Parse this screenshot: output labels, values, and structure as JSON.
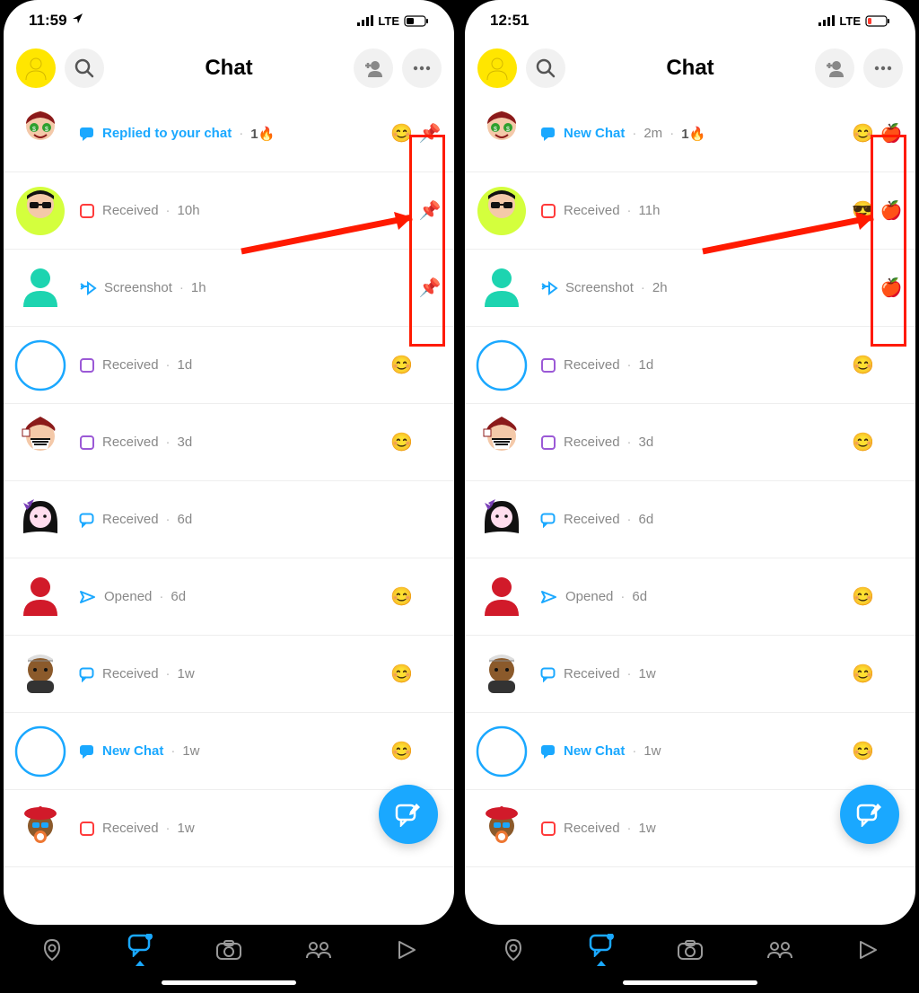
{
  "screens": [
    {
      "status": {
        "time": "11:59",
        "location_icon": true,
        "network": "LTE",
        "battery_low": false
      },
      "header": {
        "title": "Chat"
      },
      "pin_emoji": "📌",
      "rows": [
        {
          "avatar": "money-eyes",
          "status_icon": "chat-filled-blue",
          "status_text": "Replied to your chat",
          "status_bold": true,
          "time": "",
          "streak": "1",
          "right_emoji": "😊",
          "pinned": true
        },
        {
          "avatar": "sunglasses-guy",
          "status_icon": "box-outline-red",
          "status_text": "Received",
          "time": "10h",
          "right_emoji": "",
          "pinned": true
        },
        {
          "avatar": "teal-silhouette",
          "status_icon": "screenshot-blue",
          "status_text": "Screenshot",
          "time": "1h",
          "right_emoji": "",
          "pinned": true
        },
        {
          "avatar": "circle-outline-blue",
          "status_icon": "box-outline-purple",
          "status_text": "Received",
          "time": "1d",
          "right_emoji": "😊"
        },
        {
          "avatar": "mask-guy",
          "status_icon": "box-outline-purple",
          "status_text": "Received",
          "time": "3d",
          "right_emoji": "😊"
        },
        {
          "avatar": "bow-girl",
          "status_icon": "chat-outline-blue",
          "status_text": "Received",
          "time": "6d",
          "right_emoji": ""
        },
        {
          "avatar": "red-silhouette",
          "status_icon": "arrow-outline-blue",
          "status_text": "Opened",
          "time": "6d",
          "right_emoji": "😊"
        },
        {
          "avatar": "cap-guy",
          "status_icon": "chat-outline-blue",
          "status_text": "Received",
          "time": "1w",
          "right_emoji": "😊"
        },
        {
          "avatar": "circle-outline-blue",
          "status_icon": "chat-filled-blue",
          "status_text": "New Chat",
          "status_bold": true,
          "time": "1w",
          "right_emoji": "😊"
        },
        {
          "avatar": "beret-guy",
          "status_icon": "box-outline-red",
          "status_text": "Received",
          "time": "1w",
          "right_emoji": ""
        }
      ]
    },
    {
      "status": {
        "time": "12:51",
        "location_icon": false,
        "network": "LTE",
        "battery_low": true
      },
      "header": {
        "title": "Chat"
      },
      "pin_emoji": "🍎",
      "rows": [
        {
          "avatar": "money-eyes",
          "status_icon": "chat-filled-blue",
          "status_text": "New Chat",
          "status_bold": true,
          "time": "2m",
          "streak": "1",
          "right_emoji": "😊",
          "pinned": true
        },
        {
          "avatar": "sunglasses-guy",
          "status_icon": "box-outline-red",
          "status_text": "Received",
          "time": "11h",
          "right_emoji": "😎",
          "pinned": true
        },
        {
          "avatar": "teal-silhouette",
          "status_icon": "screenshot-blue",
          "status_text": "Screenshot",
          "time": "2h",
          "right_emoji": "",
          "pinned": true
        },
        {
          "avatar": "circle-outline-blue",
          "status_icon": "box-outline-purple",
          "status_text": "Received",
          "time": "1d",
          "right_emoji": "😊"
        },
        {
          "avatar": "mask-guy",
          "status_icon": "box-outline-purple",
          "status_text": "Received",
          "time": "3d",
          "right_emoji": "😊"
        },
        {
          "avatar": "bow-girl",
          "status_icon": "chat-outline-blue",
          "status_text": "Received",
          "time": "6d",
          "right_emoji": ""
        },
        {
          "avatar": "red-silhouette",
          "status_icon": "arrow-outline-blue",
          "status_text": "Opened",
          "time": "6d",
          "right_emoji": "😊"
        },
        {
          "avatar": "cap-guy",
          "status_icon": "chat-outline-blue",
          "status_text": "Received",
          "time": "1w",
          "right_emoji": "😊"
        },
        {
          "avatar": "circle-outline-blue",
          "status_icon": "chat-filled-blue",
          "status_text": "New Chat",
          "status_bold": true,
          "time": "1w",
          "right_emoji": "😊"
        },
        {
          "avatar": "beret-guy",
          "status_icon": "box-outline-red",
          "status_text": "Received",
          "time": "1w",
          "right_emoji": ""
        }
      ]
    }
  ],
  "nav": {
    "active_index": 1
  }
}
